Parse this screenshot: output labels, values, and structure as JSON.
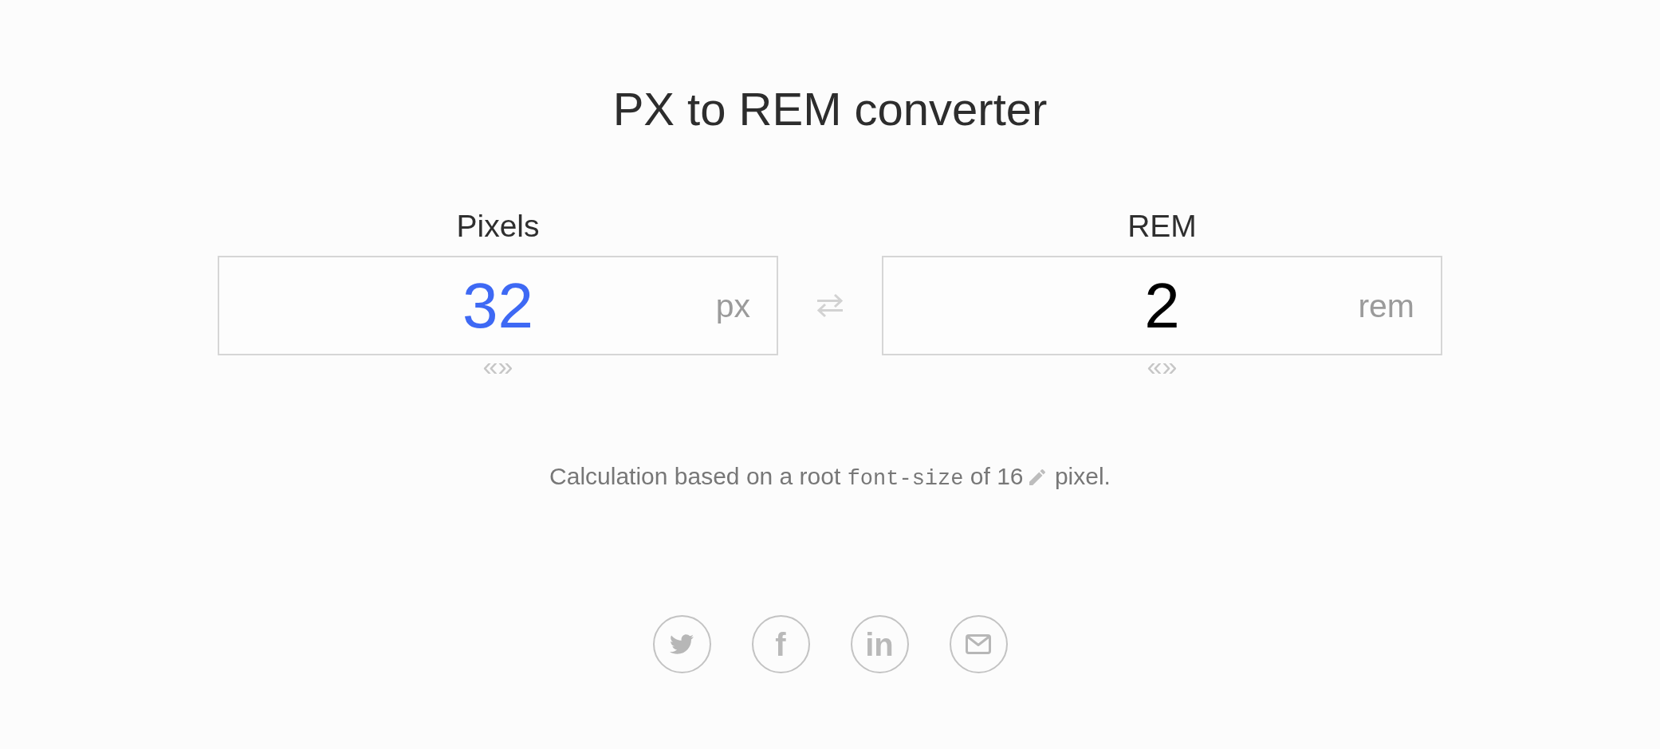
{
  "title": "PX to REM converter",
  "converters": [
    {
      "label": "Pixels",
      "value": "32",
      "unit": "px",
      "active": true,
      "handle": "«»"
    },
    {
      "label": "REM",
      "value": "2",
      "unit": "rem",
      "active": false,
      "handle": "«»"
    }
  ],
  "note": {
    "text_before": "Calculation based on a root",
    "code": "font-size",
    "text_middle": "of",
    "root_size": "16",
    "text_after": "pixel."
  },
  "share": [
    {
      "kind": "bird"
    },
    {
      "kind": "letter",
      "text": "f"
    },
    {
      "kind": "letter",
      "text": "in"
    },
    {
      "kind": "envelope"
    }
  ]
}
